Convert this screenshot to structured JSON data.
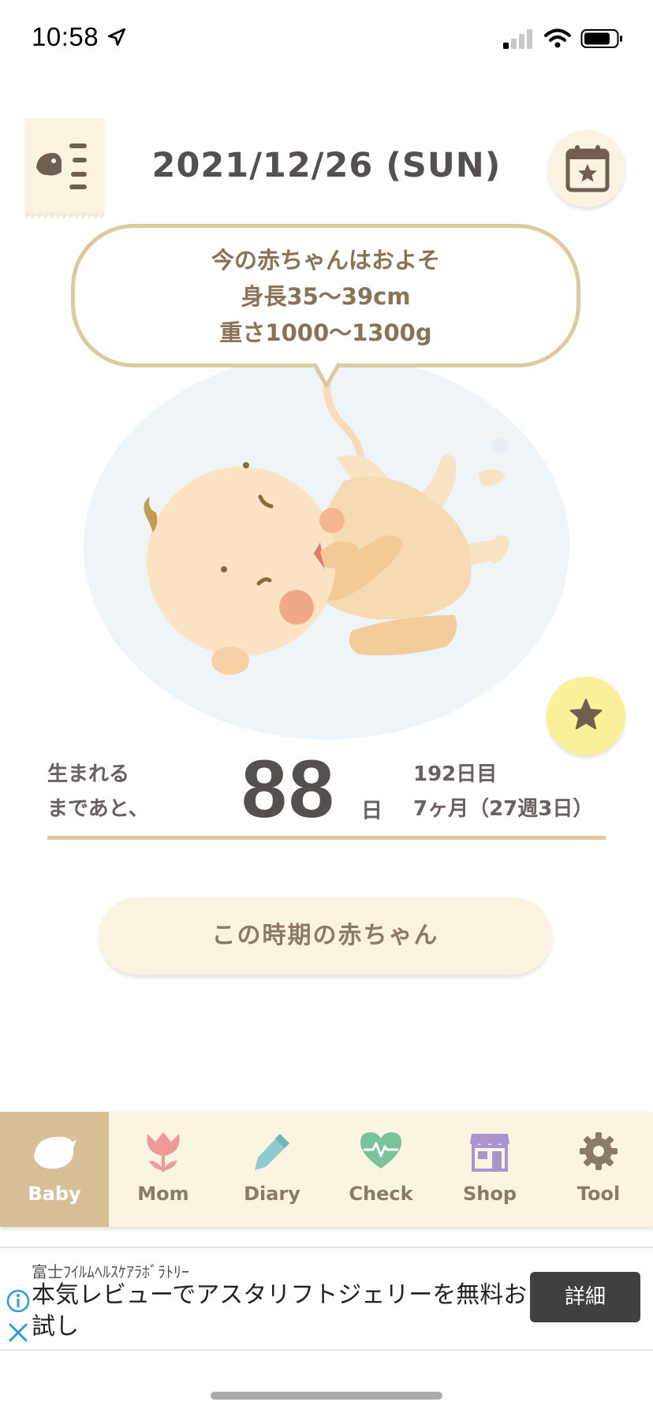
{
  "status_bar": {
    "time": "10:58"
  },
  "header": {
    "date": "2021/12/26 (SUN)"
  },
  "bubble": {
    "line1": "今の赤ちゃんはおよそ",
    "line2": "身長35〜39cm",
    "line3": "重さ1000〜1300g"
  },
  "countdown": {
    "label_line1": "生まれる",
    "label_line2": "まであと、",
    "days": "88",
    "days_unit": "日",
    "day_count": "192日目",
    "term": "7ヶ月（27週3日）"
  },
  "period_button": {
    "label": "この時期の赤ちゃん"
  },
  "tabs": [
    {
      "label": "Baby",
      "icon": "bird-icon",
      "active": true
    },
    {
      "label": "Mom",
      "icon": "tulip-icon",
      "active": false
    },
    {
      "label": "Diary",
      "icon": "pencil-icon",
      "active": false
    },
    {
      "label": "Check",
      "icon": "heart-pulse-icon",
      "active": false
    },
    {
      "label": "Shop",
      "icon": "shop-icon",
      "active": false
    },
    {
      "label": "Tool",
      "icon": "gear-icon",
      "active": false
    }
  ],
  "ad": {
    "sponsor": "富士ﾌｲﾙﾑﾍﾙｽｹｱﾗﾎﾞﾗﾄﾘｰ",
    "text": "本気レビューでアスタリフトジェリーを無料お試し",
    "button": "詳細"
  },
  "colors": {
    "accent": "#dcc99e",
    "active_tab": "#d7c098",
    "tab_bg": "#fbf4e0",
    "star_btn": "#fbf09a"
  }
}
